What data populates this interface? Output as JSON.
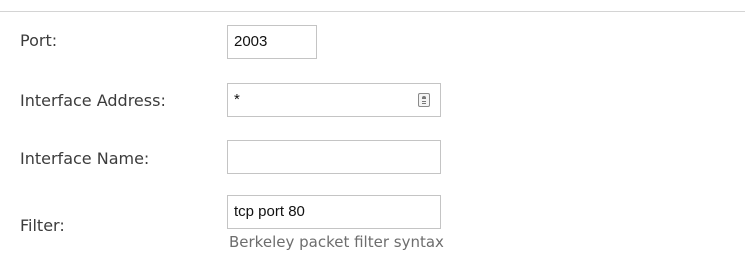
{
  "section": {
    "heading": ""
  },
  "form": {
    "port": {
      "label": "Port:",
      "value": "2003"
    },
    "interface_address": {
      "label": "Interface Address:",
      "value": "*",
      "icon": "contact-card-icon"
    },
    "interface_name": {
      "label": "Interface Name:",
      "value": ""
    },
    "filter": {
      "label": "Filter:",
      "value": "tcp port 80",
      "hint": "Berkeley packet filter syntax"
    }
  }
}
